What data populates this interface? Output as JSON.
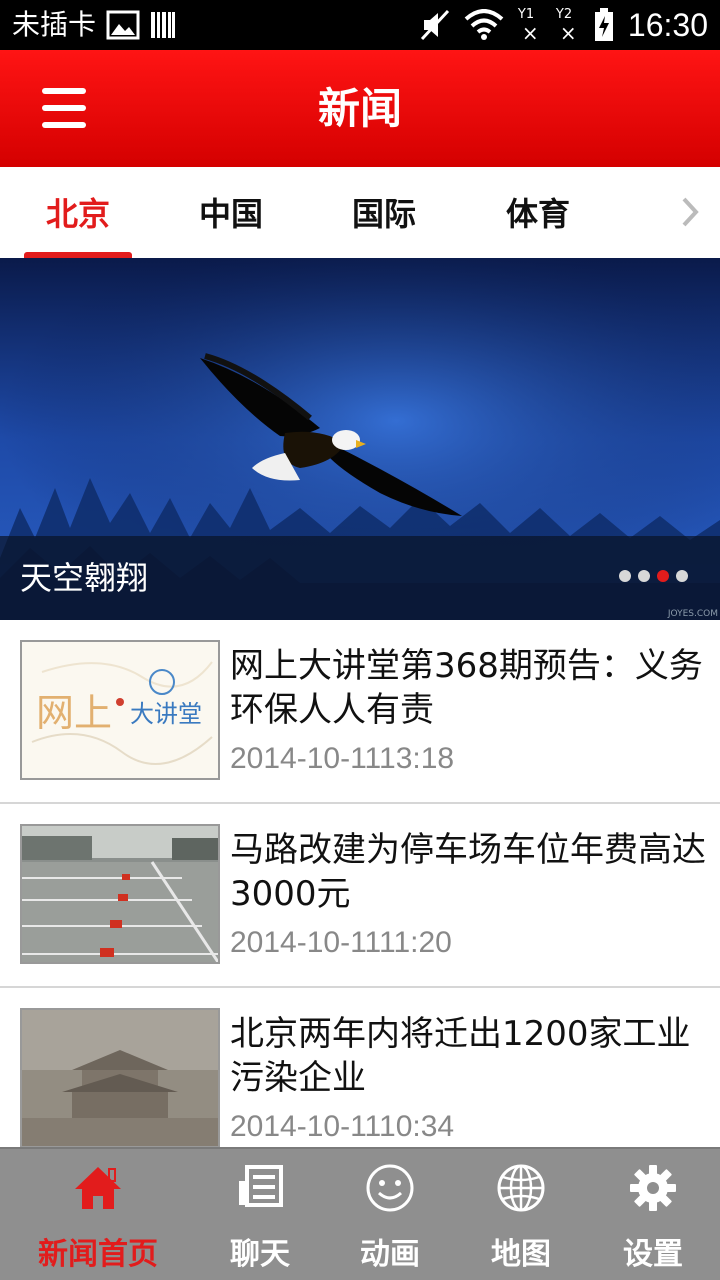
{
  "status_bar": {
    "carrier": "未插卡",
    "sim1": "Y1",
    "sim2": "Y2",
    "time": "16:30"
  },
  "header": {
    "title": "新闻"
  },
  "tabs": [
    {
      "label": "北京",
      "active": true
    },
    {
      "label": "中国",
      "active": false
    },
    {
      "label": "国际",
      "active": false
    },
    {
      "label": "体育",
      "active": false
    }
  ],
  "banner": {
    "caption": "天空翱翔",
    "slide_count": 4,
    "active_slide": 3,
    "watermark": "JOYES.COM"
  },
  "news": [
    {
      "title": "网上大讲堂第368期预告：义务环保人人有责",
      "date": "2014-10-1113:18",
      "thumb_text_1": "网上",
      "thumb_text_2": "大讲堂"
    },
    {
      "title": "马路改建为停车场车位年费高达3000元",
      "date": "2014-10-1111:20"
    },
    {
      "title": "北京两年内将迁出1200家工业污染企业",
      "date": "2014-10-1110:34"
    }
  ],
  "bottom_nav": [
    {
      "label": "新闻首页",
      "icon": "home-icon",
      "active": true
    },
    {
      "label": "聊天",
      "icon": "newspaper-icon",
      "active": false
    },
    {
      "label": "动画",
      "icon": "smiley-icon",
      "active": false
    },
    {
      "label": "地图",
      "icon": "globe-icon",
      "active": false
    },
    {
      "label": "设置",
      "icon": "gear-icon",
      "active": false
    }
  ],
  "colors": {
    "accent": "#e21c1c",
    "header_bg": "#ff1414",
    "nav_bg": "#8f8f8f",
    "date_text": "#888888"
  }
}
